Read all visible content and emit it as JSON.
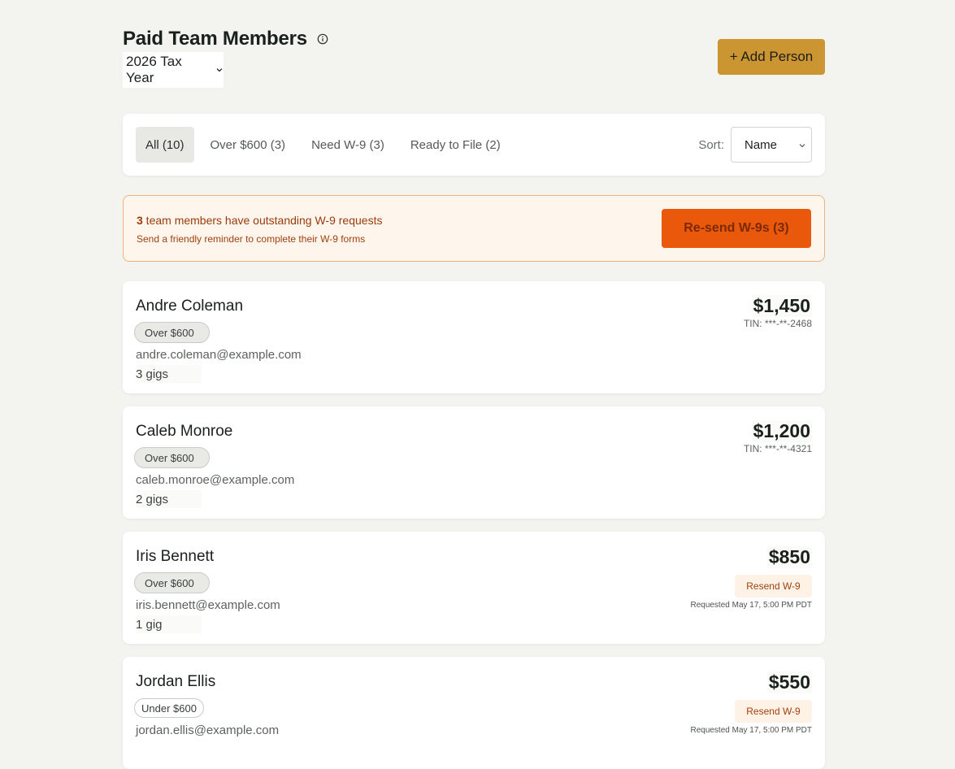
{
  "header": {
    "title": "Paid Team Members",
    "tax_year": "2026 Tax Year",
    "add_button": "+ Add Person"
  },
  "filters": {
    "tabs": [
      {
        "label": "All (10)",
        "active": true
      },
      {
        "label": "Over $600 (3)",
        "active": false
      },
      {
        "label": "Need W-9 (3)",
        "active": false
      },
      {
        "label": "Ready to File (2)",
        "active": false
      }
    ],
    "sort_label": "Sort:",
    "sort_value": "Name"
  },
  "alert": {
    "count": "3",
    "title_rest": " team members have outstanding W-9 requests",
    "subtitle": "Send a friendly reminder to complete their W-9 forms",
    "button": "Re-send W-9s (3)"
  },
  "members": [
    {
      "name": "Andre Coleman",
      "badge": "Over $600",
      "email": "andre.coleman@example.com",
      "gigs": "3 gigs",
      "amount": "$1,450",
      "tin": "TIN: ***-**-2468"
    },
    {
      "name": "Caleb Monroe",
      "badge": "Over $600",
      "email": "caleb.monroe@example.com",
      "gigs": "2 gigs",
      "amount": "$1,200",
      "tin": "TIN: ***-**-4321"
    },
    {
      "name": "Iris Bennett",
      "badge": "Over $600",
      "email": "iris.bennett@example.com",
      "gigs": "1 gig",
      "amount": "$850",
      "resend": "Resend W-9",
      "requested": "Requested May 17, 5:00 PM PDT"
    },
    {
      "name": "Jordan Ellis",
      "badge": "Under $600",
      "email": "jordan.ellis@example.com",
      "amount": "$550",
      "resend": "Resend W-9",
      "requested": "Requested May 17, 5:00 PM PDT"
    }
  ],
  "colors": {
    "background": "#f3f3ef",
    "add_button": "#cb9632",
    "alert_bg": "#fef5ec",
    "alert_accent": "#ea580c"
  }
}
